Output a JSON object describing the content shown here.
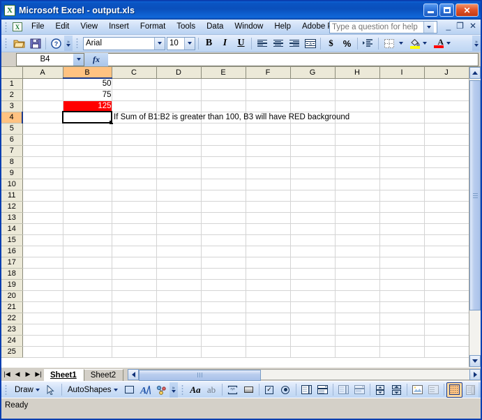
{
  "window": {
    "title": "Microsoft Excel - output.xls",
    "app_icon": "excel-icon",
    "minimize_label": "Minimize",
    "maximize_label": "Maximize",
    "close_label": "Close"
  },
  "menu": {
    "items": [
      {
        "label": "File"
      },
      {
        "label": "Edit"
      },
      {
        "label": "View"
      },
      {
        "label": "Insert"
      },
      {
        "label": "Format"
      },
      {
        "label": "Tools"
      },
      {
        "label": "Data"
      },
      {
        "label": "Window"
      },
      {
        "label": "Help"
      },
      {
        "label": "Adobe PDF"
      }
    ],
    "help_placeholder": "Type a question for help",
    "doc_minimize": "_",
    "doc_restore": "❐",
    "doc_close": "✕"
  },
  "toolbar": {
    "open_label": "Open",
    "save_label": "Save",
    "help_label": "Help",
    "font_name": "Arial",
    "font_size": "10",
    "bold_label": "B",
    "italic_label": "I",
    "underline_label": "U",
    "align_left_label": "Align Left",
    "align_center_label": "Center",
    "align_right_label": "Align Right",
    "merge_label": "Merge and Center",
    "currency_label": "$",
    "percent_label": "%",
    "indent_label": "Increase Indent",
    "borders_label": "Borders",
    "fill_color_label": "Fill Color",
    "font_color_label": "Font Color",
    "fill_color": "#ffff00",
    "font_color": "#ff0000",
    "overflow_label": "Toolbar Options"
  },
  "formula_bar": {
    "name_box_value": "B4",
    "fx_label": "fx",
    "formula_value": ""
  },
  "grid": {
    "columns": [
      "A",
      "B",
      "C",
      "D",
      "E",
      "F",
      "G",
      "H",
      "I",
      "J"
    ],
    "selected_column": "B",
    "selected_row": 4,
    "selected_cell": "B4",
    "rows": [
      1,
      2,
      3,
      4,
      5,
      6,
      7,
      8,
      9,
      10,
      11,
      12,
      13,
      14,
      15,
      16,
      17,
      18,
      19,
      20,
      21,
      22,
      23,
      24,
      25
    ],
    "cells": {
      "B1": {
        "value": "50",
        "align": "right"
      },
      "B2": {
        "value": "75",
        "align": "right"
      },
      "B3": {
        "value": "125",
        "align": "right",
        "background": "#ff0000",
        "color": "#ffffff"
      },
      "C4": {
        "value": "If Sum of B1:B2 is greater than 100, B3 will have RED background",
        "align": "left"
      }
    }
  },
  "sheet_tabs": {
    "first_label": "First Sheet",
    "prev_label": "Previous Sheet",
    "next_label": "Next Sheet",
    "last_label": "Last Sheet",
    "tabs": [
      {
        "label": "Sheet1",
        "active": true
      },
      {
        "label": "Sheet2",
        "active": false
      }
    ]
  },
  "drawing_toolbar": {
    "draw_label": "Draw",
    "select_label": "Select Objects",
    "autoshapes_label": "AutoShapes",
    "rectangle_label": "Rectangle",
    "wordart_label": "Insert WordArt",
    "diagram_label": "Insert Diagram"
  },
  "control_toolbox": {
    "font_label": "Aa",
    "label_label": "ab",
    "textbox_label": "xyz",
    "commandbutton_label": "Command Button",
    "checkbox_label": "Check Box",
    "optionbutton_label": "Option Button",
    "listbox_label": "List Box",
    "combobox_label": "Combo Box",
    "togglebutton_label": "Toggle Button",
    "spinbutton_label": "Spin Button",
    "scrollbar_label": "Scroll Bar",
    "image_label": "Image",
    "moreconstrols_label": "More Controls",
    "designmode_label": "Design Mode",
    "properties_label": "Properties"
  },
  "status_bar": {
    "status_text": "Ready"
  }
}
